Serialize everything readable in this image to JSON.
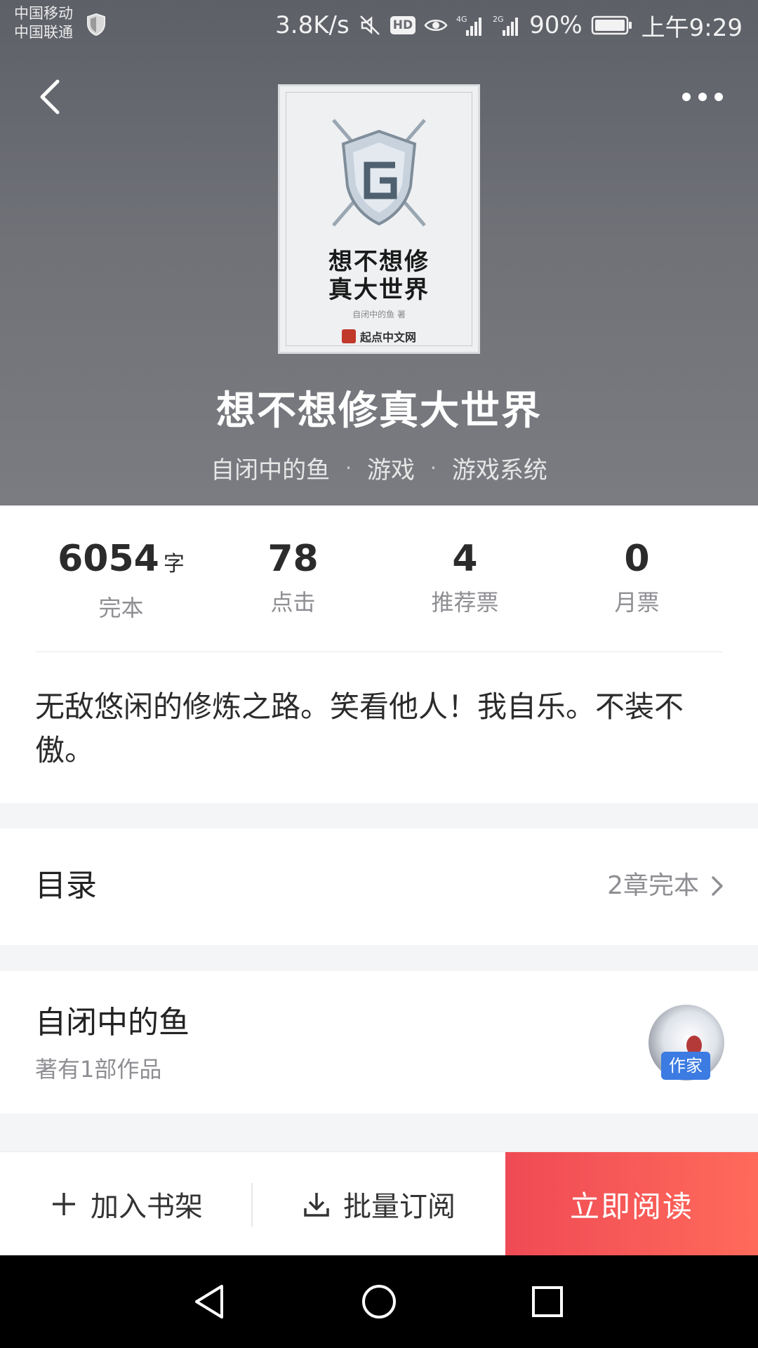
{
  "status_bar": {
    "carrier_1": "中国移动",
    "carrier_2": "中国联通",
    "net_speed": "3.8K/s",
    "hd_label": "HD",
    "battery": "90%",
    "time": "上午9:29"
  },
  "cover": {
    "title_line1": "想不想修",
    "title_line2": "真大世界",
    "author_line": "自闭中的鱼 著",
    "publisher": "起点中文网"
  },
  "book": {
    "title": "想不想修真大世界",
    "author": "自闭中的鱼",
    "category": "游戏",
    "subcategory": "游戏系统",
    "separator": "·"
  },
  "stats": [
    {
      "value": "6054",
      "unit": "字",
      "label": "完本"
    },
    {
      "value": "78",
      "unit": "",
      "label": "点击"
    },
    {
      "value": "4",
      "unit": "",
      "label": "推荐票"
    },
    {
      "value": "0",
      "unit": "",
      "label": "月票"
    }
  ],
  "intro": "无敌悠闲的修炼之路。笑看他人！我自乐。不装不傲。",
  "toc": {
    "title": "目录",
    "summary": "2章完本"
  },
  "author_card": {
    "name": "自闭中的鱼",
    "works": "著有1部作品",
    "badge": "作家"
  },
  "actions": {
    "add_shelf": "加入书架",
    "bulk_subscribe": "批量订阅",
    "read_now": "立即阅读"
  },
  "colors": {
    "accent_start": "#ef4a55",
    "accent_end": "#ff6a5a",
    "badge_blue": "#3b7be2"
  }
}
